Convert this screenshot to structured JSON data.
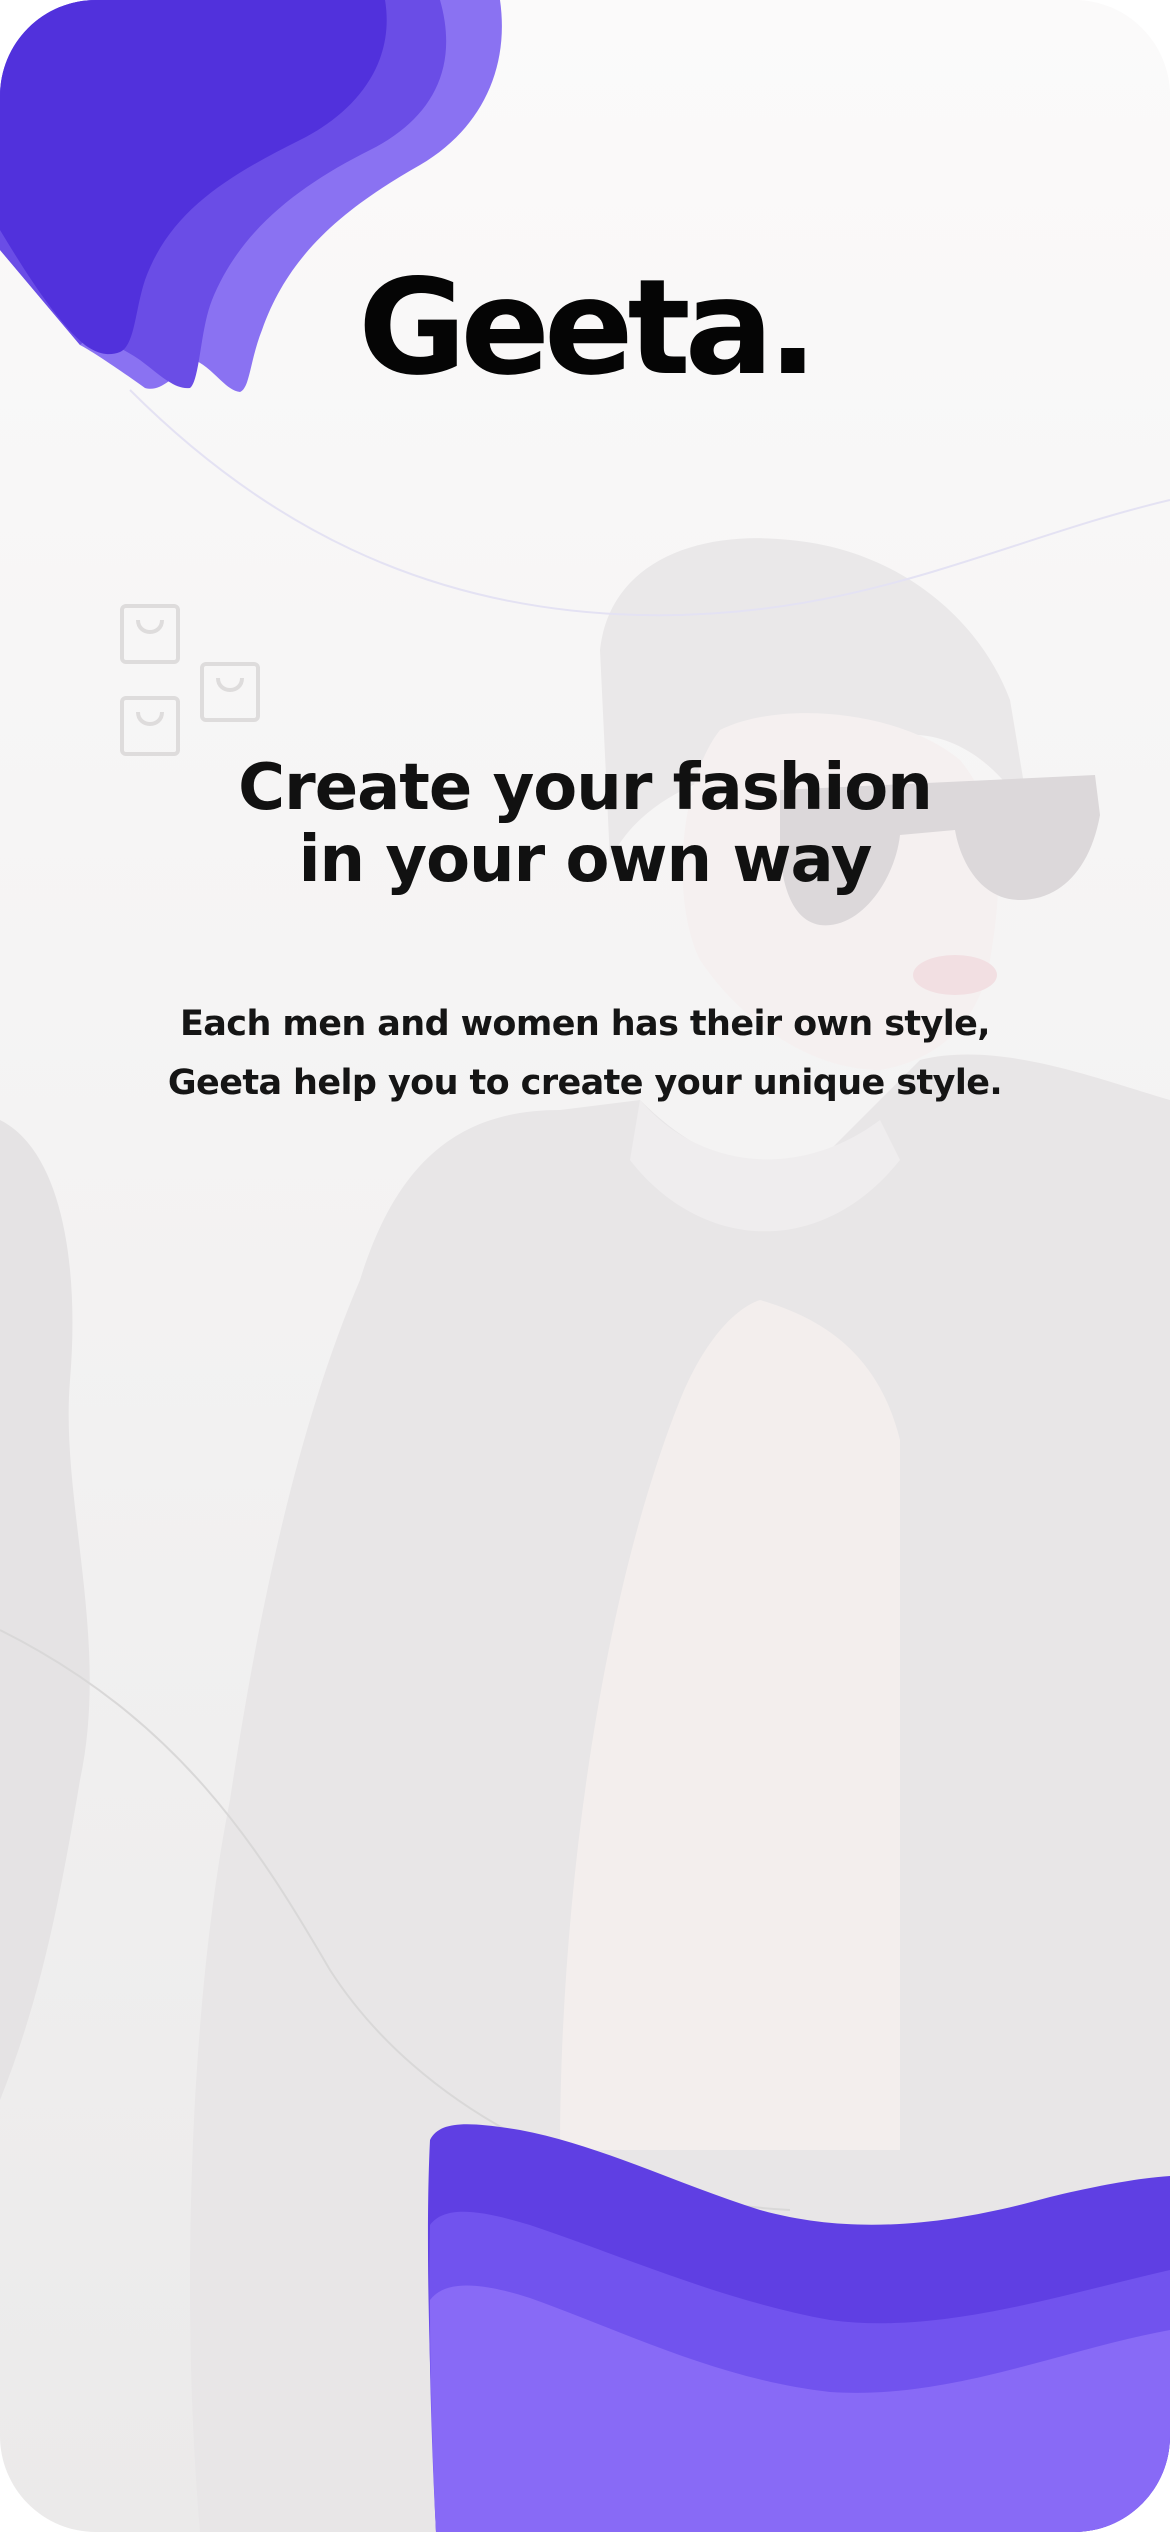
{
  "brand": {
    "name": "Geeta."
  },
  "onboarding": {
    "headline": "Create your fashion\nin your own way",
    "description": "Each men and women has their own style, Geeta help you to create your unique style."
  },
  "decor": {
    "top_wave_icon": "purple-wave-shape",
    "bottom_wave_icon": "purple-wave-shape",
    "bag_icon": "shopping-bag-icon",
    "background_image": "fashion-model-photo"
  },
  "colors": {
    "accent_dark": "#5233dc",
    "accent_mid": "#6a4bea",
    "accent_light": "#8b6ef5",
    "background": "#fbfafa",
    "text": "#111111"
  }
}
